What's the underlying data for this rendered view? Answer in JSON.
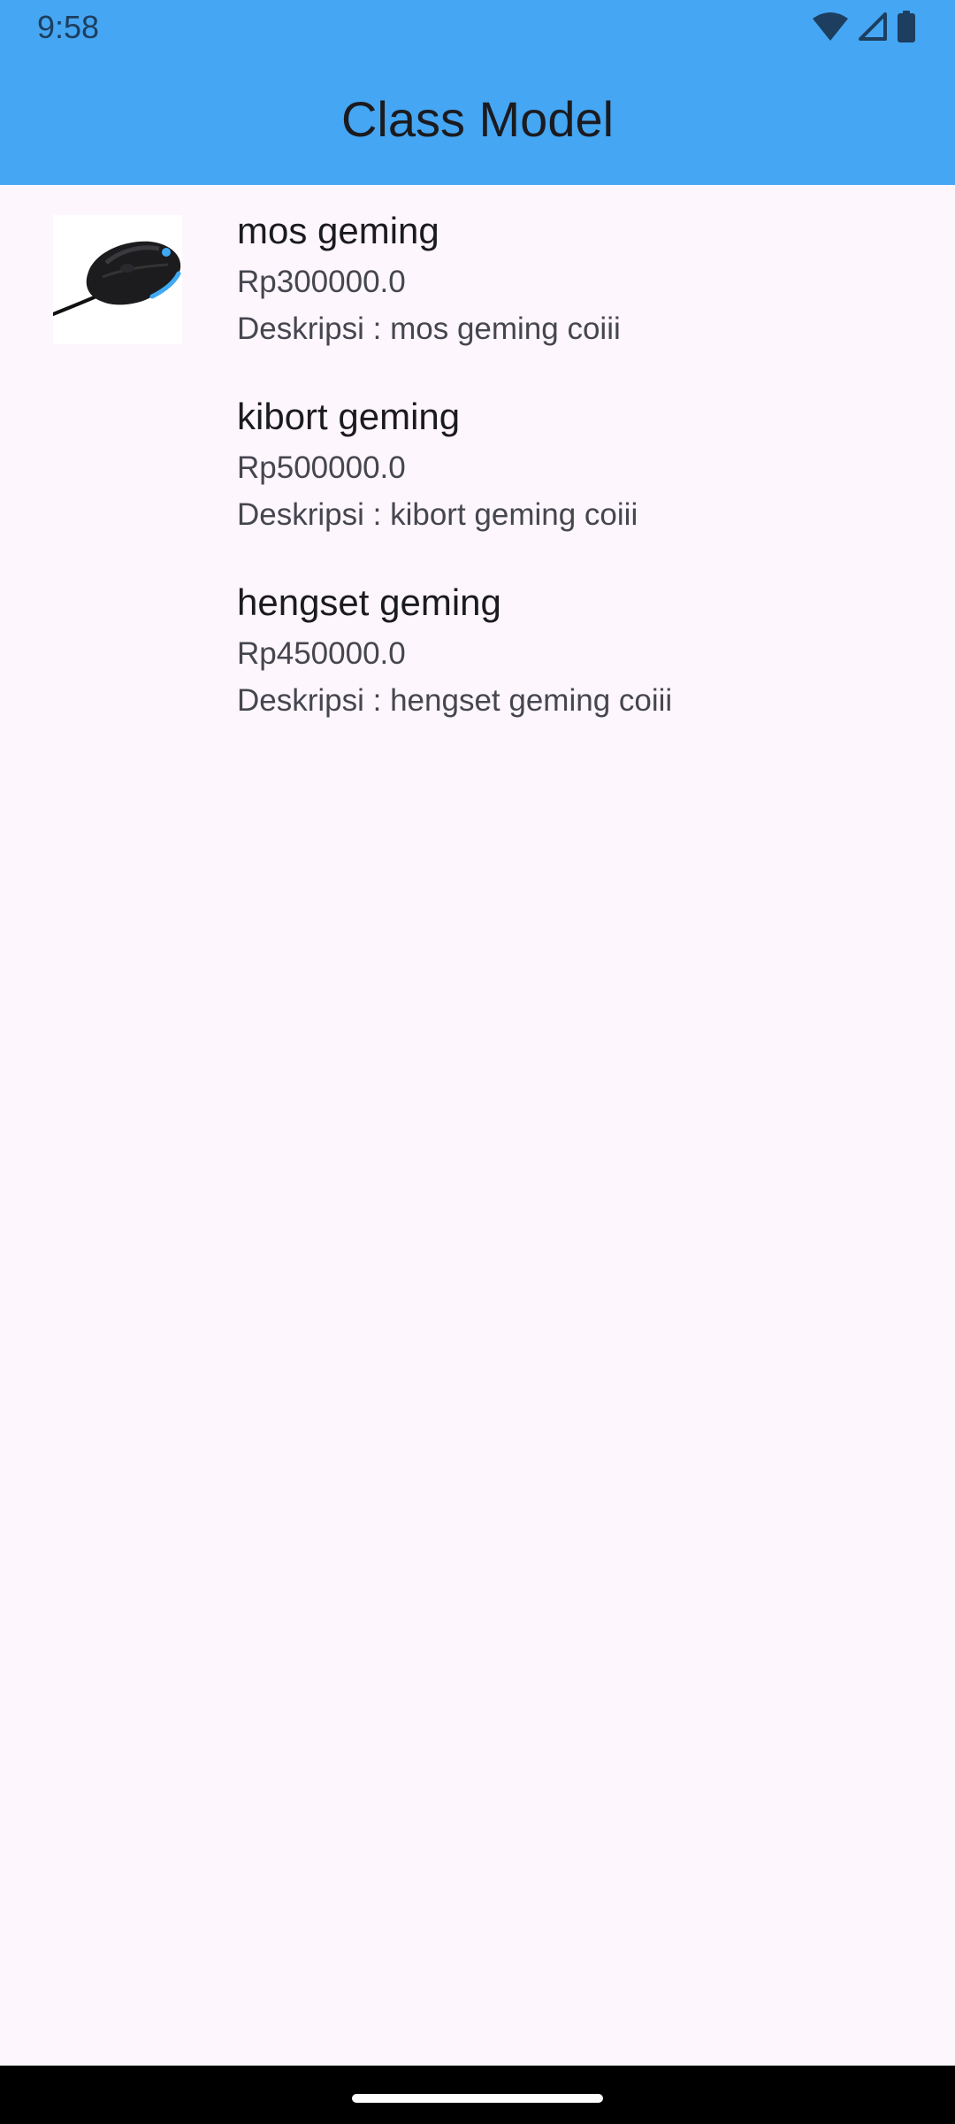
{
  "status_bar": {
    "time": "9:58",
    "icons": [
      "wifi-icon",
      "signal-icon",
      "battery-icon"
    ]
  },
  "app_bar": {
    "title": "Class Model",
    "background": "#45A6F3"
  },
  "products": [
    {
      "name": "mos geming",
      "price": "Rp300000.0",
      "desc_label": "Deskripsi : ",
      "desc": "mos geming coiii",
      "image": "gaming-mouse-image"
    },
    {
      "name": "kibort geming",
      "price": "Rp500000.0",
      "desc_label": "Deskripsi : ",
      "desc": "kibort geming coiii",
      "image": ""
    },
    {
      "name": "hengset geming",
      "price": "Rp450000.0",
      "desc_label": "Deskripsi : ",
      "desc": "hengset geming coiii",
      "image": ""
    }
  ],
  "colors": {
    "page_background": "#FDF6FD",
    "title_text": "#1B1B1F",
    "secondary_text": "#46464F"
  }
}
